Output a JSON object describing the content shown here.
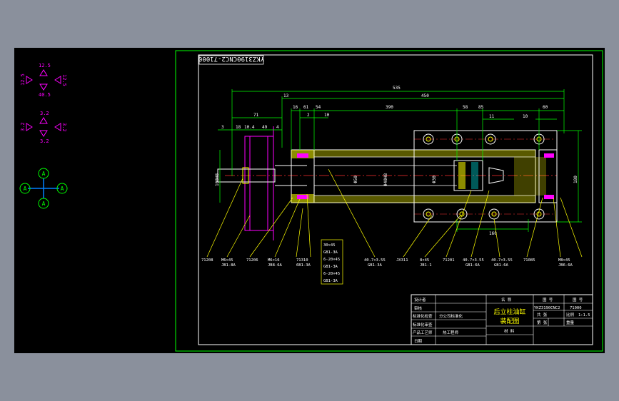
{
  "colors": {
    "background": "#8a909c",
    "canvas": "#000000",
    "frame": "#00ff00",
    "white": "#ffffff",
    "dimension": "#00ff00",
    "leader": "#ffff00",
    "symbols": "#ff00ff",
    "section": "#ff00ff",
    "centerline": "#ff3030",
    "hatch": "#ffff00"
  },
  "drawing": {
    "code_stamp": "YKZ3190CNC2-71000",
    "top_dims": {
      "overall": "535",
      "right": "450",
      "left": "13",
      "d16": "16",
      "d61": "61",
      "d54": "54",
      "d390": "390",
      "d58": "58",
      "d85": "85",
      "d60": "60",
      "d2": "2",
      "d10": "10",
      "d11": "11",
      "d10b": "10",
      "d71": "71",
      "d3": "3",
      "d18": "18",
      "d10c": "10.4",
      "d49": "49",
      "d4": "4",
      "d160": "160"
    },
    "vertical_dims": {
      "left_height": "100H8",
      "bore": "Φ50",
      "rod": "Φ40H8",
      "right_height": "180",
      "end": "Φ30"
    },
    "part_labels": [
      "71208",
      "M6×45",
      "JB1-8A",
      "71206",
      "M6×16",
      "JB8-6A",
      "71310",
      "6B1-3A",
      "40.7×3.55",
      "GB1-3A",
      "JX311",
      "8×45",
      "JB1-1",
      "71201",
      "40.7×3.55",
      "GB1-6A",
      "40.7×3.55",
      "GB1-6A",
      "71085",
      "M8×45",
      "JB6-6A"
    ],
    "note_box": [
      "30×45",
      "GB1-3A",
      "6-20×45",
      "GB1-3A",
      "6-20×45",
      "GB1-3A"
    ]
  },
  "symbols": {
    "roughness_top": {
      "up": "12.5",
      "left": "12.5",
      "right": "12.5",
      "down": "40.5"
    },
    "roughness_mid": {
      "up": "3.2",
      "left": "3.2",
      "right": "3.2",
      "down": "3.2"
    },
    "datum": {
      "label": "A"
    }
  },
  "title_block": {
    "rows_left": [
      "设计者",
      "审核",
      "标准化检查",
      "标准化审查",
      "产品工艺师",
      "日期"
    ],
    "stamp1": "分公司标准化",
    "stamp2": "热工程师",
    "col_head1": "名 称",
    "title_line1": "后立柱油缸",
    "title_line2": "装配图",
    "col_head2": "材 料",
    "col_head3": "图 号",
    "col_head4": "图 号",
    "drawing_no_a": "YKZ3190CNC2",
    "drawing_no_b": "71000",
    "sheet_label": "共 张",
    "scale_label": "比例",
    "scale_value": "1:1.5",
    "sheet_of": "第 张",
    "weight_label": "重量"
  }
}
